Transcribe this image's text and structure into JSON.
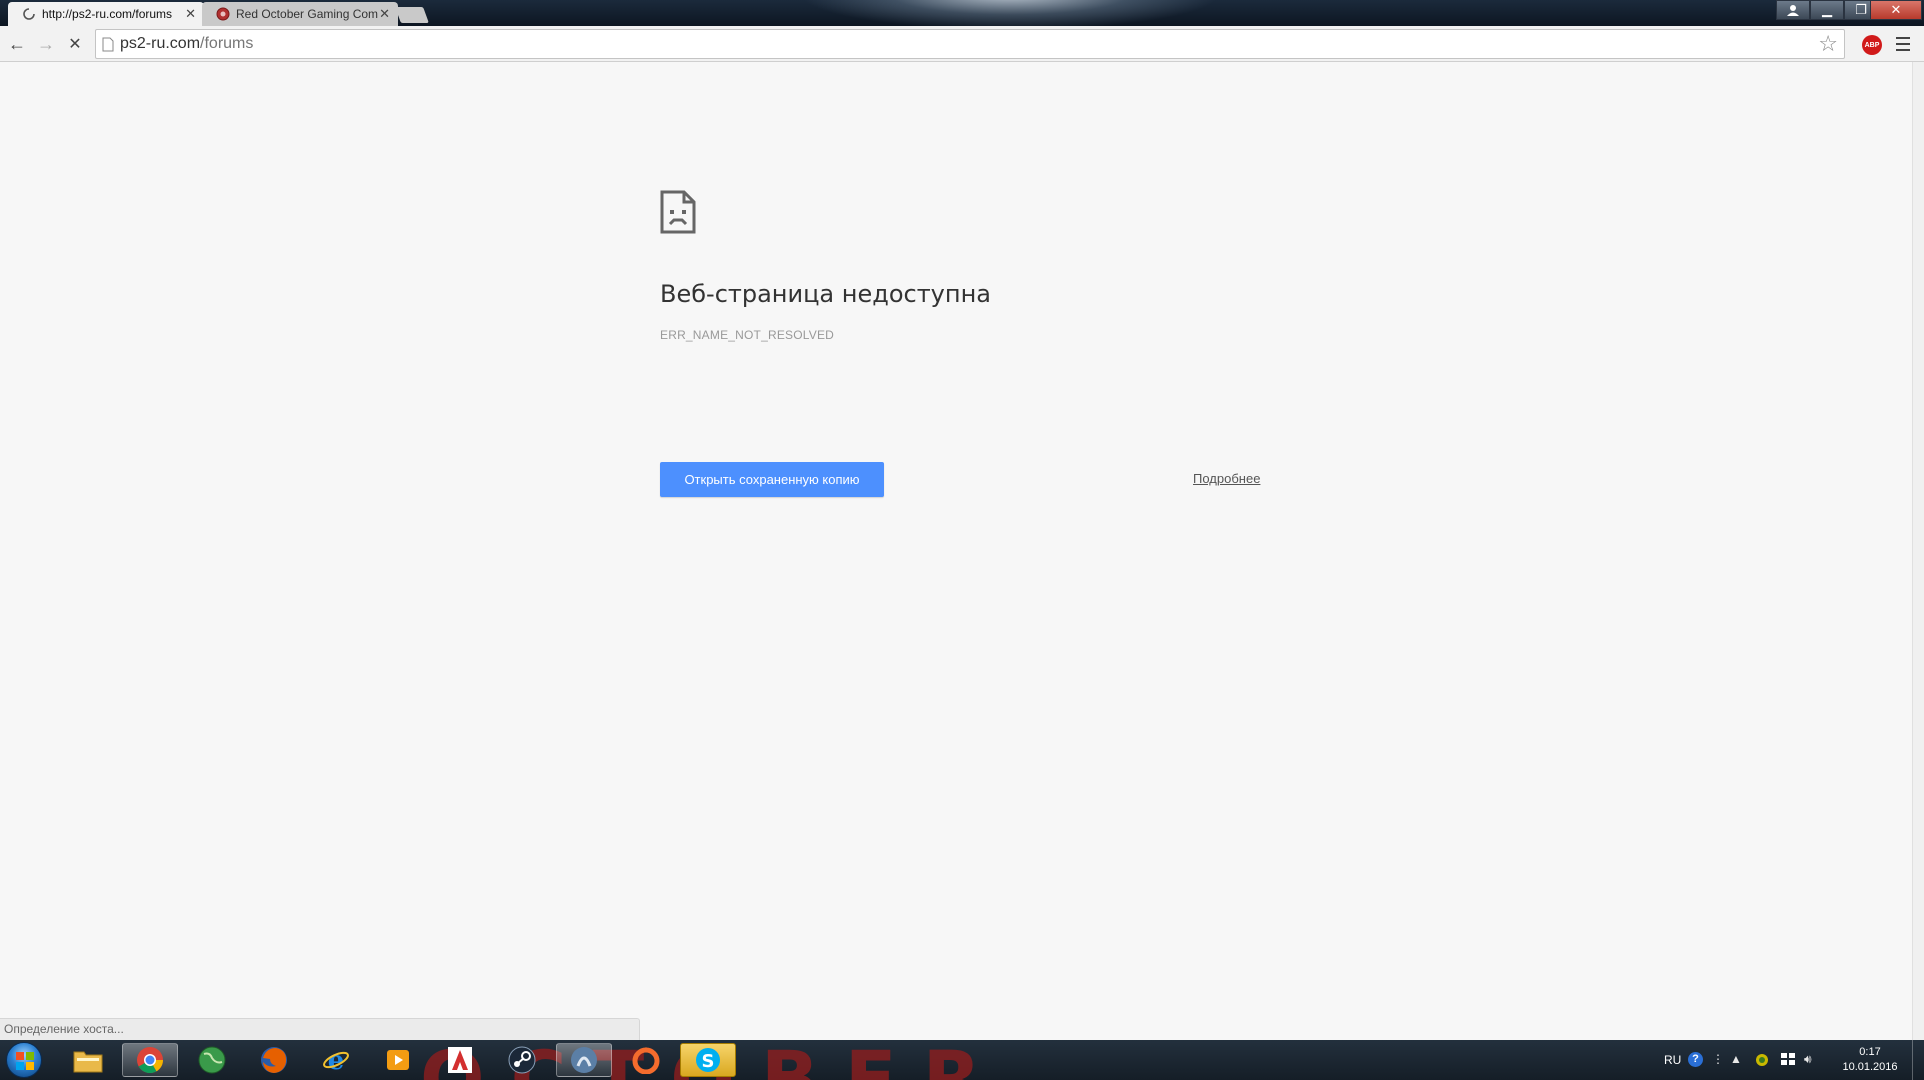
{
  "browser": {
    "tabs": [
      {
        "label": "http://ps2-ru.com/forums",
        "active": true
      },
      {
        "label": "Red October Gaming Com",
        "active": false
      }
    ],
    "address": {
      "host": "ps2-ru.com",
      "path": "/forums"
    },
    "abp_label": "ABP"
  },
  "page": {
    "error_title": "Веб-страница недоступна",
    "error_code": "ERR_NAME_NOT_RESOLVED",
    "primary_button": "Открыть сохраненную копию",
    "details_link": "Подробнее"
  },
  "status_bar": {
    "text": "Определение хоста..."
  },
  "taskbar": {
    "wallpaper_text": "OCTOBER",
    "apps": [
      {
        "name": "file-explorer",
        "color": "#e9b949"
      },
      {
        "name": "chrome",
        "color": "#4285f4",
        "active": true
      },
      {
        "name": "globe",
        "color": "#4caf50"
      },
      {
        "name": "firefox",
        "color": "#e66000"
      },
      {
        "name": "internet-explorer",
        "color": "#1e88e5"
      },
      {
        "name": "media-player",
        "color": "#f39c12"
      },
      {
        "name": "adobe",
        "color": "#d32f2f"
      },
      {
        "name": "steam",
        "color": "#1b2838"
      },
      {
        "name": "app-blue",
        "color": "#5b7fa6"
      },
      {
        "name": "origin",
        "color": "#f56c2d"
      },
      {
        "name": "skype",
        "color": "#00aff0",
        "highlight": true
      }
    ],
    "tray": {
      "language": "RU",
      "help": "?",
      "time": "0:17",
      "date": "10.01.2016"
    }
  }
}
